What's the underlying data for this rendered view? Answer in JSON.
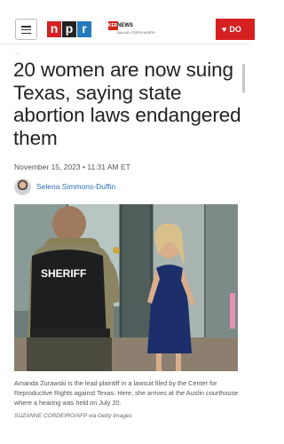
{
  "header": {
    "menu_icon": "hamburger-menu-icon",
    "npr_letters": [
      "n",
      "p",
      "r"
    ],
    "npr_colors": [
      "#d62021",
      "#222222",
      "#237bbd"
    ],
    "station": {
      "top": "KERA",
      "main": "NEWS",
      "sub": "DALLAS • FORTH WORTH"
    },
    "donate": {
      "icon": "heart-icon",
      "label": "DO"
    }
  },
  "article": {
    "section": "..",
    "headline": "20 women are now suing Texas, saying state abortion laws endangered them",
    "date": "November 15, 2023 • 11:31 AM ET",
    "author": "Selena Simmons-Duffin",
    "photo": {
      "badge_text": "SHERIFF"
    },
    "caption": "Amanda Zurawski is the lead plaintiff in a lawsuit filed by the Center for Reproductive Rights against Texas. Here, she arrives at the Austin courthouse where a hearing was held on July 20.",
    "credit": "SUZANNE CORDEIRO/AFP via Getty Images"
  },
  "colors": {
    "accent_red": "#d62021",
    "link_blue": "#2a6ebb"
  }
}
